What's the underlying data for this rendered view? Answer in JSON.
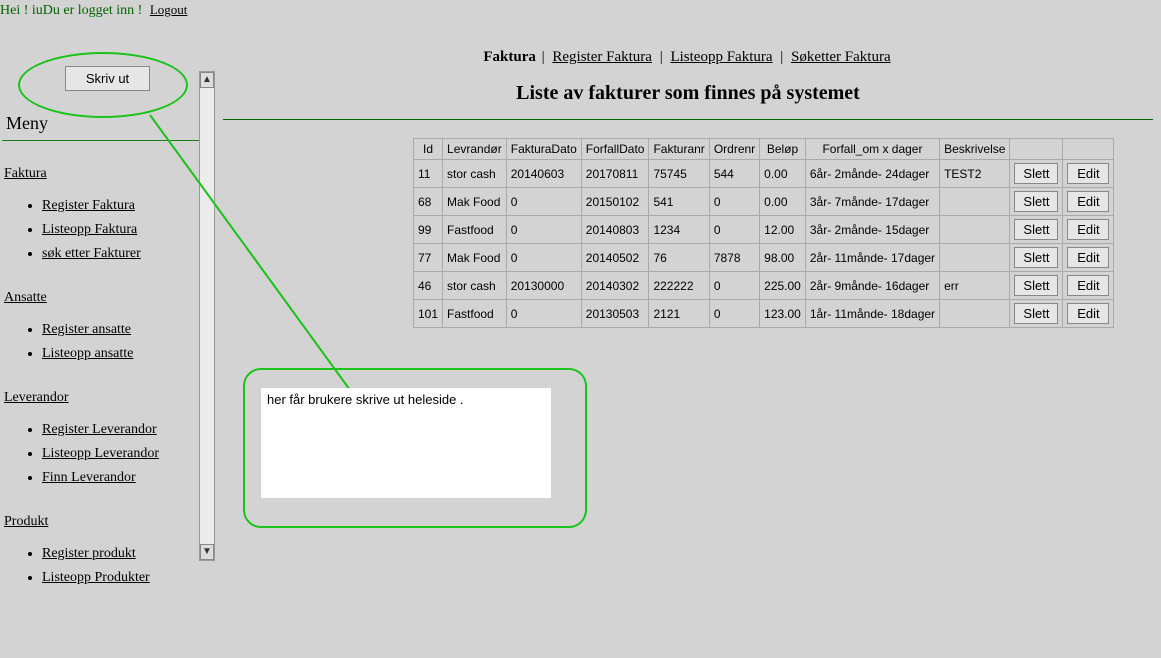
{
  "topbar": {
    "greeting_prefix": "Hei ! ",
    "greeting_user": "iu",
    "logged_in_text": "Du er logget inn ! ",
    "logout": "Logout"
  },
  "sidebar": {
    "print_label": "Skriv ut",
    "menu_heading": "Meny",
    "sections": [
      {
        "title": "Faktura",
        "items": [
          "Register Faktura",
          "Listeopp Faktura",
          "søk etter Fakturer"
        ]
      },
      {
        "title": "Ansatte",
        "items": [
          "Register ansatte",
          "Listeopp ansatte"
        ]
      },
      {
        "title": "Leverandor",
        "items": [
          "Register Leverandor",
          "Listeopp Leverandor",
          "Finn Leverandor"
        ]
      },
      {
        "title": "Produkt",
        "items": [
          "Register produkt",
          "Listeopp Produkter"
        ]
      }
    ]
  },
  "breadcrumb": {
    "main": "Faktura",
    "links": [
      "Register Faktura",
      "Listeopp Faktura",
      "Søketter Faktura"
    ]
  },
  "page_title": "Liste av fakturer som finnes på systemet",
  "table": {
    "headers": [
      "Id",
      "Levrandør",
      "FakturaDato",
      "ForfallDato",
      "Fakturanr",
      "Ordrenr",
      "Beløp",
      "Forfall_om x dager",
      "Beskrivelse"
    ],
    "slett_label": "Slett",
    "edit_label": "Edit",
    "rows": [
      {
        "id": "11",
        "lev": "stor cash",
        "fd": "20140603",
        "ffd": "20170811",
        "fn": "75745",
        "on": "544",
        "bel": "0.00",
        "forf": "6år- 2månde- 24dager",
        "besk": "TEST2"
      },
      {
        "id": "68",
        "lev": "Mak Food",
        "fd": "0",
        "ffd": "20150102",
        "fn": "541",
        "on": "0",
        "bel": "0.00",
        "forf": "3år- 7månde- 17dager",
        "besk": ""
      },
      {
        "id": "99",
        "lev": "Fastfood",
        "fd": "0",
        "ffd": "20140803",
        "fn": "1234",
        "on": "0",
        "bel": "12.00",
        "forf": "3år- 2månde- 15dager",
        "besk": ""
      },
      {
        "id": "77",
        "lev": "Mak Food",
        "fd": "0",
        "ffd": "20140502",
        "fn": "76",
        "on": "7878",
        "bel": "98.00",
        "forf": "2år- 11månde- 17dager",
        "besk": ""
      },
      {
        "id": "46",
        "lev": "stor cash",
        "fd": "20130000",
        "ffd": "20140302",
        "fn": "222222",
        "on": "0",
        "bel": "225.00",
        "forf": "2år- 9månde- 16dager",
        "besk": "err"
      },
      {
        "id": "101",
        "lev": "Fastfood",
        "fd": "0",
        "ffd": "20130503",
        "fn": "2121",
        "on": "0",
        "bel": "123.00",
        "forf": "1år- 11månde- 18dager",
        "besk": ""
      }
    ]
  },
  "annotation": {
    "text": "her får brukere skrive ut heleside ."
  }
}
